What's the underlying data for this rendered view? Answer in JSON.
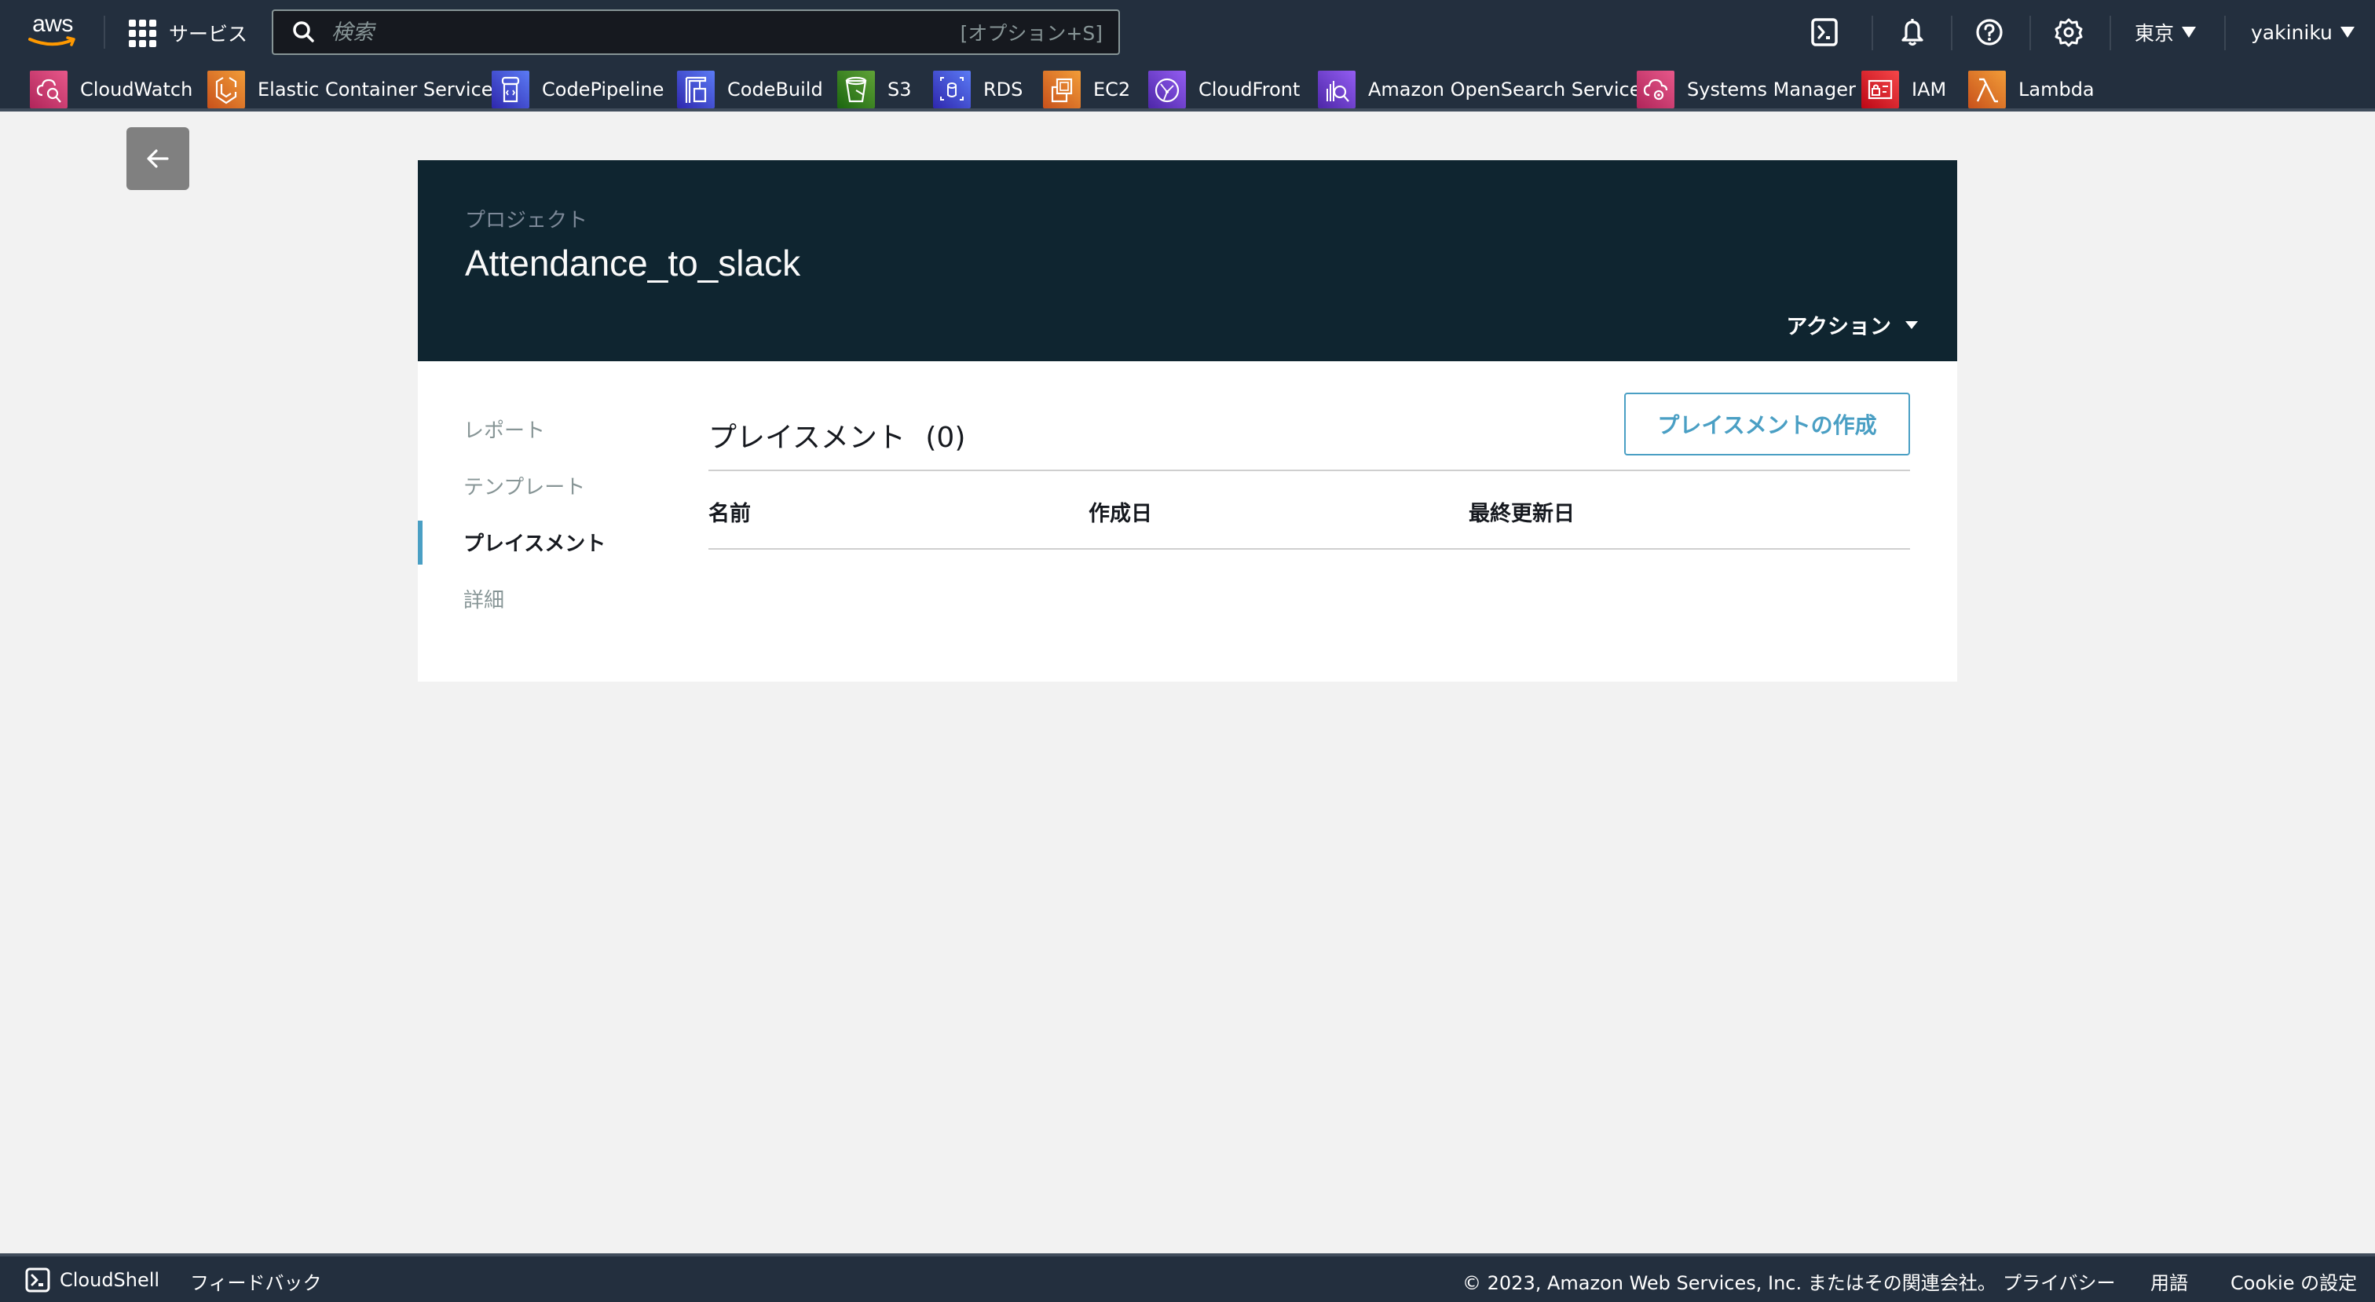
{
  "topnav": {
    "logo_text": "aws",
    "services_label": "サービス",
    "search": {
      "placeholder": "検索",
      "value": "",
      "shortcut": "[オプション+S]"
    },
    "icons": [
      "cloudshell-icon",
      "bell-icon",
      "help-icon",
      "settings-icon"
    ],
    "region_label": "東京",
    "user_label": "yakiniku"
  },
  "favorites": [
    {
      "label": "CloudWatch",
      "icon": "cloudwatch-icon",
      "color_from": "#e7588a",
      "color_to": "#b0255a"
    },
    {
      "label": "Elastic Container Service",
      "icon": "ecs-icon",
      "color_from": "#f29d38",
      "color_to": "#c8511b"
    },
    {
      "label": "CodePipeline",
      "icon": "codepipeline-icon",
      "color_from": "#5b7bf5",
      "color_to": "#2e27ad"
    },
    {
      "label": "CodeBuild",
      "icon": "codebuild-icon",
      "color_from": "#5b7bf5",
      "color_to": "#2e27ad"
    },
    {
      "label": "S3",
      "icon": "s3-icon",
      "color_from": "#60a337",
      "color_to": "#1b660f"
    },
    {
      "label": "RDS",
      "icon": "rds-icon",
      "color_from": "#5b7bf5",
      "color_to": "#2e27ad"
    },
    {
      "label": "EC2",
      "icon": "ec2-icon",
      "color_from": "#f29d38",
      "color_to": "#c8511b"
    },
    {
      "label": "CloudFront",
      "icon": "cloudfront-icon",
      "color_from": "#945df2",
      "color_to": "#4d27a8"
    },
    {
      "label": "Amazon OpenSearch Service",
      "icon": "opensearch-icon",
      "color_from": "#945df2",
      "color_to": "#4d27a8"
    },
    {
      "label": "Systems Manager",
      "icon": "systems-manager-icon",
      "color_from": "#e7588a",
      "color_to": "#b0255a"
    },
    {
      "label": "IAM",
      "icon": "iam-icon",
      "color_from": "#f54749",
      "color_to": "#bd0816"
    },
    {
      "label": "Lambda",
      "icon": "lambda-icon",
      "color_from": "#f29d38",
      "color_to": "#c8511b"
    }
  ],
  "project": {
    "breadcrumb_label": "プロジェクト",
    "title": "Attendance_to_slack",
    "actions_label": "アクション"
  },
  "sidenav": {
    "items": [
      {
        "label": "レポート",
        "active": false
      },
      {
        "label": "テンプレート",
        "active": false
      },
      {
        "label": "プレイスメント",
        "active": true
      },
      {
        "label": "詳細",
        "active": false
      }
    ]
  },
  "placements": {
    "title": "プレイスメント",
    "count": "(0)",
    "create_button": "プレイスメントの作成",
    "columns": [
      "名前",
      "作成日",
      "最終更新日"
    ],
    "rows": []
  },
  "footer": {
    "cloudshell": "CloudShell",
    "feedback": "フィードバック",
    "copyright": "© 2023, Amazon Web Services, Inc. またはその関連会社。",
    "privacy": "プライバシー",
    "terms": "用語",
    "cookie": "Cookie の設定"
  },
  "colors": {
    "nav_bg": "#232f3e",
    "header_bg": "#0f2530",
    "accent": "#4a9fc4"
  }
}
